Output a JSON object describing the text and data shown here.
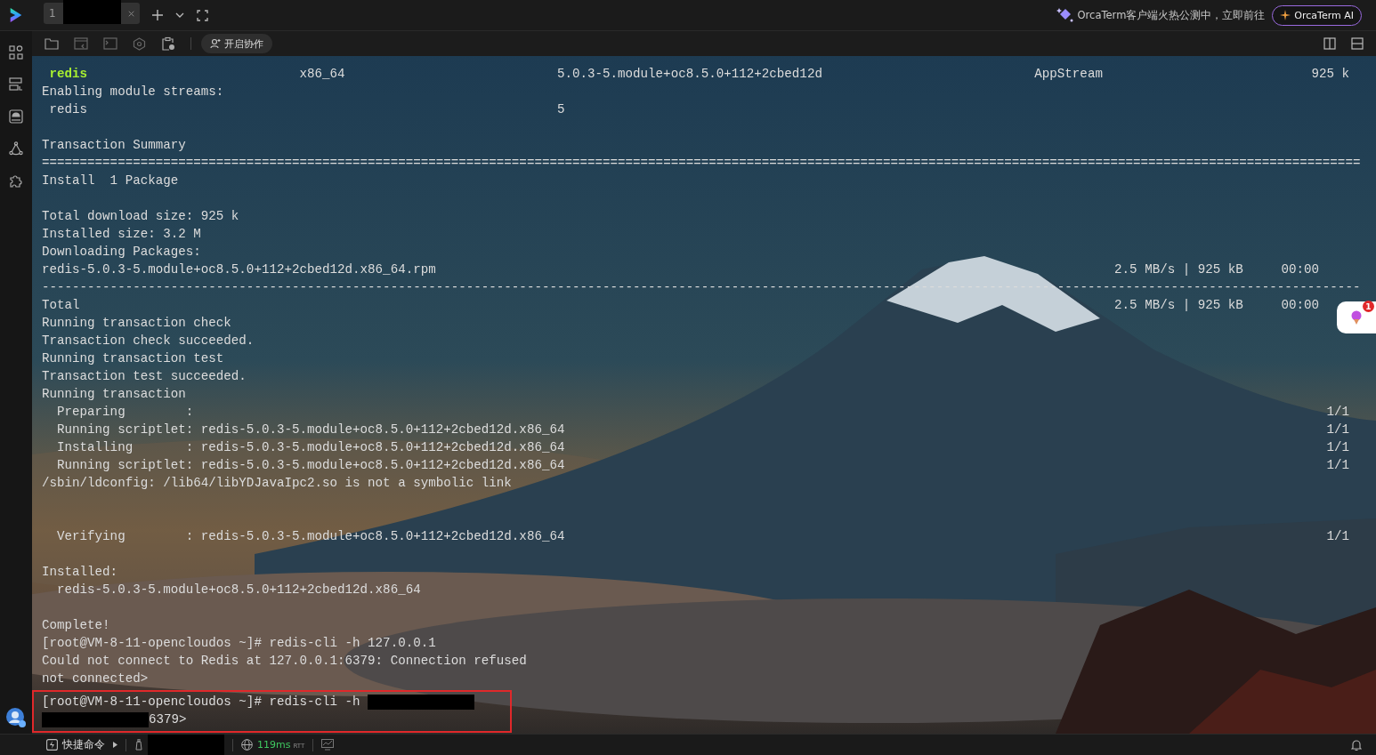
{
  "top_bar": {
    "tabs": [
      {
        "number": "1",
        "selected": true
      }
    ],
    "promo_text": "OrcaTerm客户端火热公测中，立即前往",
    "ai_button": "OrcaTerm AI"
  },
  "toolbar": {
    "collab_button": "开启协作"
  },
  "terminal": {
    "lines": [
      {
        "kind": "package",
        "name": "redis",
        "arch": "x86_64",
        "version": "5.0.3-5.module+oc8.5.0+112+2cbed12d",
        "repository": "AppStream",
        "size": "925 k"
      },
      {
        "kind": "text",
        "text": "Enabling module streams:"
      },
      {
        "kind": "stream",
        "name": "redis",
        "stream": "5"
      },
      {
        "kind": "blank"
      },
      {
        "kind": "text",
        "text": "Transaction Summary"
      },
      {
        "kind": "text",
        "text": "=============================================================================================================================================================================="
      },
      {
        "kind": "text",
        "text": "Install  1 Package"
      },
      {
        "kind": "blank"
      },
      {
        "kind": "text",
        "text": "Total download size: 925 k"
      },
      {
        "kind": "text",
        "text": "Installed size: 3.2 M"
      },
      {
        "kind": "text",
        "text": "Downloading Packages:"
      },
      {
        "kind": "transfer",
        "text": "redis-5.0.3-5.module+oc8.5.0+112+2cbed12d.x86_64.rpm",
        "right": "2.5 MB/s | 925 kB     00:00"
      },
      {
        "kind": "text",
        "text": "------------------------------------------------------------------------------------------------------------------------------------------------------------------------------"
      },
      {
        "kind": "transfer",
        "text": "Total",
        "right": "2.5 MB/s | 925 kB     00:00"
      },
      {
        "kind": "text",
        "text": "Running transaction check"
      },
      {
        "kind": "text",
        "text": "Transaction check succeeded."
      },
      {
        "kind": "text",
        "text": "Running transaction test"
      },
      {
        "kind": "text",
        "text": "Transaction test succeeded."
      },
      {
        "kind": "text",
        "text": "Running transaction"
      },
      {
        "kind": "progress",
        "text": "  Preparing        :",
        "right": "1/1"
      },
      {
        "kind": "progress",
        "text": "  Running scriptlet: redis-5.0.3-5.module+oc8.5.0+112+2cbed12d.x86_64",
        "right": "1/1"
      },
      {
        "kind": "progress",
        "text": "  Installing       : redis-5.0.3-5.module+oc8.5.0+112+2cbed12d.x86_64",
        "right": "1/1"
      },
      {
        "kind": "progress",
        "text": "  Running scriptlet: redis-5.0.3-5.module+oc8.5.0+112+2cbed12d.x86_64",
        "right": "1/1"
      },
      {
        "kind": "text",
        "text": "/sbin/ldconfig: /lib64/libYDJavaIpc2.so is not a symbolic link"
      },
      {
        "kind": "blank"
      },
      {
        "kind": "blank"
      },
      {
        "kind": "progress",
        "text": "  Verifying        : redis-5.0.3-5.module+oc8.5.0+112+2cbed12d.x86_64",
        "right": "1/1"
      },
      {
        "kind": "blank"
      },
      {
        "kind": "text",
        "text": "Installed:"
      },
      {
        "kind": "text",
        "text": "  redis-5.0.3-5.module+oc8.5.0+112+2cbed12d.x86_64"
      },
      {
        "kind": "blank"
      },
      {
        "kind": "text",
        "text": "Complete!"
      },
      {
        "kind": "text",
        "text": "[root@VM-8-11-opencloudos ~]# redis-cli -h 127.0.0.1"
      },
      {
        "kind": "text",
        "text": "Could not connect to Redis at 127.0.0.1:6379: Connection refused"
      },
      {
        "kind": "text",
        "text": "not connected>"
      }
    ],
    "highlighted_lines": [
      {
        "text": "[root@VM-8-11-opencloudos ~]# redis-cli -h ",
        "redacted_after": true
      },
      {
        "text": "6379>",
        "redacted_before": true
      }
    ]
  },
  "notification": {
    "badge": "1"
  },
  "status_bar": {
    "quick_commands": "快捷命令",
    "latency": "119ms",
    "latency_unit": "RTT"
  }
}
